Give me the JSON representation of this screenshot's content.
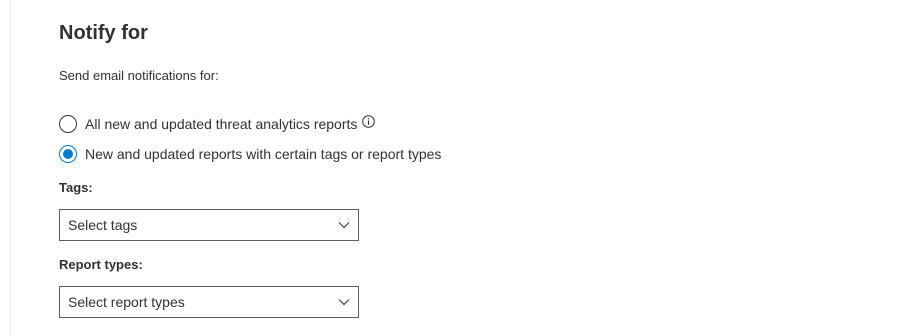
{
  "section": {
    "title": "Notify for",
    "subtitle": "Send email notifications for:"
  },
  "radio_options": [
    {
      "label": "All new and updated threat analytics reports",
      "checked": false,
      "has_info_icon": true
    },
    {
      "label": "New and updated reports with certain tags or report types",
      "checked": true,
      "has_info_icon": false
    }
  ],
  "tags": {
    "label": "Tags:",
    "placeholder": "Select tags"
  },
  "report_types": {
    "label": "Report types:",
    "placeholder": "Select report types"
  },
  "colors": {
    "accent": "#0078d4",
    "text": "#323130",
    "border": "#605e5c"
  },
  "icons": {
    "info": "info-icon",
    "dropdown": "chevron-down-icon"
  }
}
